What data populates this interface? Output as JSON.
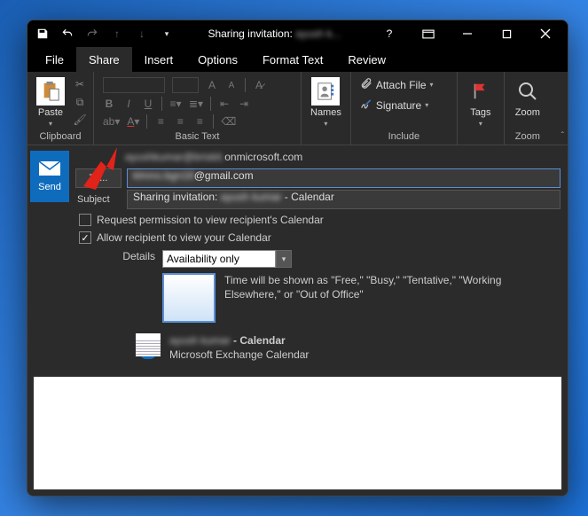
{
  "titlebar": {
    "title_prefix": "Sharing invitation:",
    "title_blur": "ayush k..."
  },
  "menutabs": [
    "File",
    "Share",
    "Insert",
    "Options",
    "Format Text",
    "Review"
  ],
  "active_tab_index": 1,
  "ribbon": {
    "clipboard": {
      "paste": "Paste",
      "label": "Clipboard"
    },
    "basictext": {
      "label": "Basic Text"
    },
    "names": {
      "btn": "Names",
      "label": ""
    },
    "include": {
      "attach": "Attach File",
      "signature": "Signature",
      "label": "Include"
    },
    "tags": {
      "btn": "Tags",
      "label": ""
    },
    "zoom": {
      "btn": "Zoom",
      "label": "Zoom"
    }
  },
  "compose": {
    "send": "Send",
    "from_blur": "ayushkumar@briskit.",
    "from_domain": "onmicrosoft.com",
    "to_label": "To...",
    "to_blur": "klmno.bgn18",
    "to_suffix": "@gmail.com",
    "subject_label": "Subject",
    "subject_prefix": "Sharing invitation:",
    "subject_blur": "ayush kumar",
    "subject_suffix": "- Calendar",
    "chk_request": "Request permission to view recipient's Calendar",
    "chk_request_on": false,
    "chk_allow": "Allow recipient to view your Calendar",
    "chk_allow_on": true,
    "details_label": "Details",
    "details_value": "Availability only",
    "preview_text": "Time will be shown as \"Free,\" \"Busy,\" \"Tentative,\" \"Working Elsewhere,\" or \"Out of Office\"",
    "cal_line1_blur": "ayush kumar",
    "cal_line1_suffix": "- Calendar",
    "cal_line2": "Microsoft Exchange Calendar"
  }
}
